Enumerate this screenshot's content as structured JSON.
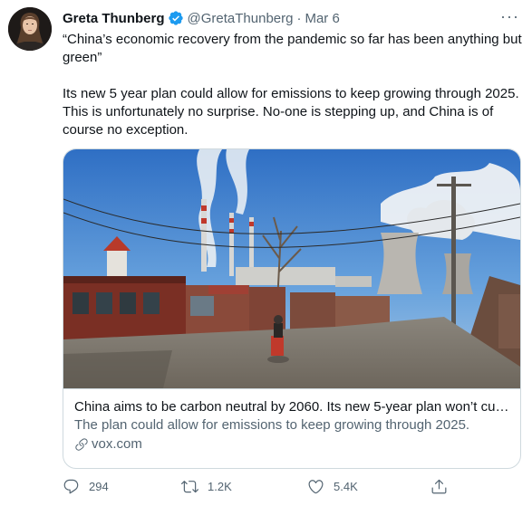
{
  "tweet": {
    "display_name": "Greta Thunberg",
    "handle": "@GretaThunberg",
    "separator": "·",
    "date": "Mar 6",
    "more_label": "···",
    "text_quote": "“China’s economic recovery from the pandemic so far has been anything but green”",
    "text_body": "Its new 5 year plan could allow for emissions to keep growing through 2025. This is unfortunately no surprise. No-one is stepping up, and China is of course no exception."
  },
  "card": {
    "title": "China aims to be carbon neutral by 2060. Its new 5-year plan won’t cut…",
    "description": "The plan could allow for emissions to keep growing through 2025.",
    "domain": "vox.com"
  },
  "actions": {
    "reply_count": "294",
    "retweet_count": "1.2K",
    "like_count": "5.4K"
  },
  "colors": {
    "verified": "#1d9bf0",
    "secondary_text": "#536471",
    "border": "#cfd9de"
  },
  "icons": [
    "verified-badge-icon",
    "more-icon",
    "link-icon",
    "reply-icon",
    "retweet-icon",
    "like-icon",
    "share-icon"
  ]
}
